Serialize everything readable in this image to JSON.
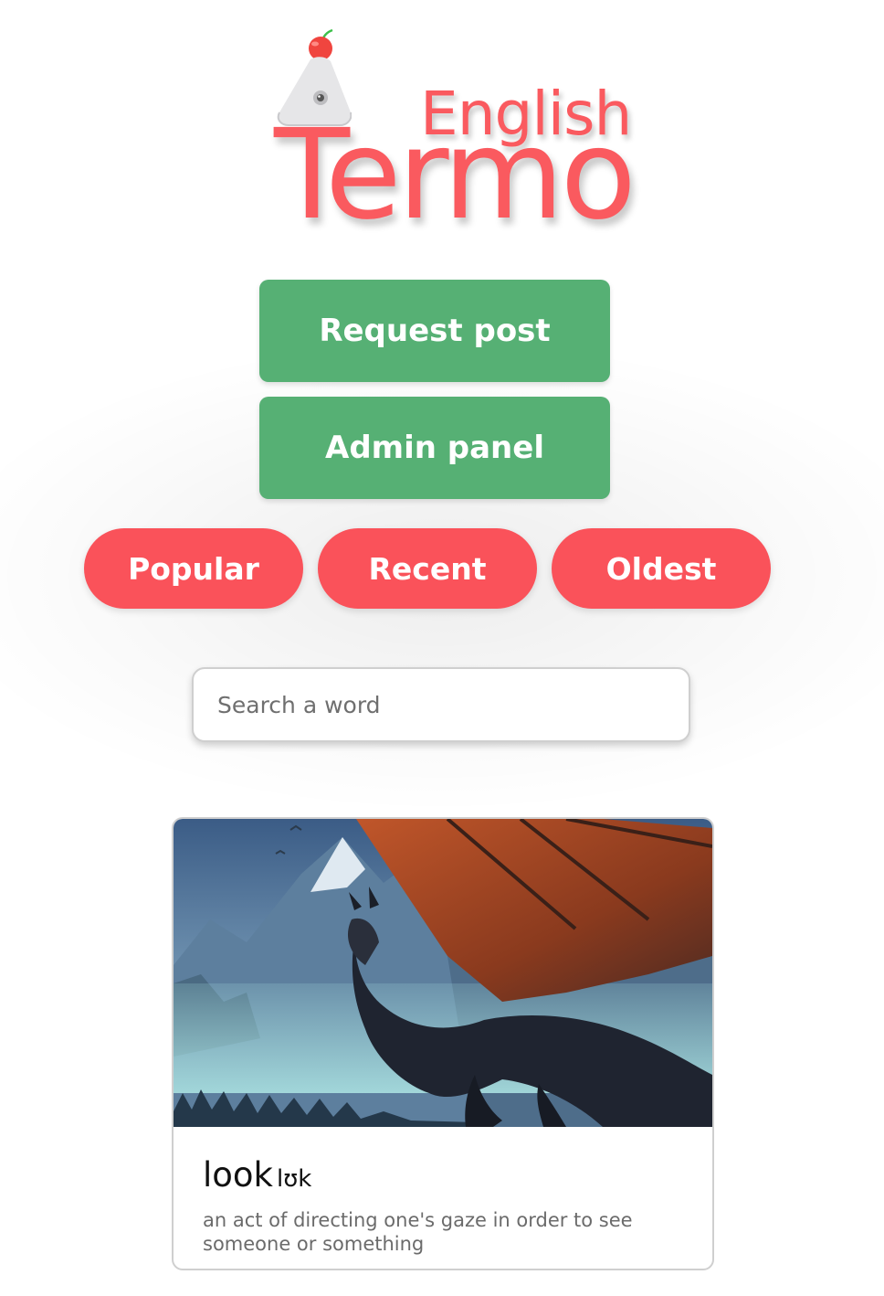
{
  "logo": {
    "line1": "English",
    "line2": "Termo",
    "color": "#fa5a5f"
  },
  "actions": {
    "request_post_label": "Request post",
    "admin_panel_label": "Admin panel",
    "color": "#56b074"
  },
  "sort": {
    "popular_label": "Popular",
    "recent_label": "Recent",
    "oldest_label": "Oldest",
    "color": "#fa525a"
  },
  "search": {
    "placeholder": "Search a word",
    "value": ""
  },
  "posts": [
    {
      "word": "look",
      "phonetic": "lʊk",
      "definition": "an act of directing one's gaze in order to see someone or something",
      "image_subject": "dragon-over-mountains"
    }
  ]
}
